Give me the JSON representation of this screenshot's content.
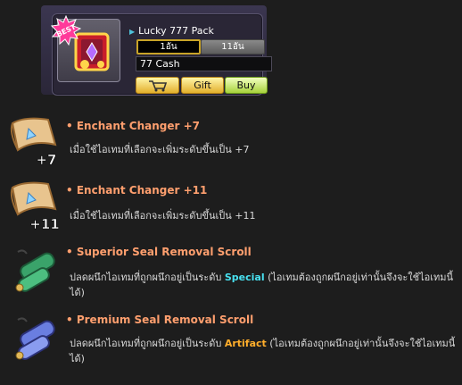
{
  "shop": {
    "title": "Lucky 777 Pack",
    "badge": "BEST",
    "options": [
      "1อัน",
      "11อัน"
    ],
    "price": "77 Cash",
    "gift_label": "Gift",
    "buy_label": "Buy",
    "cart_icon": "cart-icon"
  },
  "items": [
    {
      "name": "• Enchant Changer +7",
      "desc_before": "เมื่อใช้ไอเทมที่เลือกจะเพิ่มระดับขึ้นเป็น +7",
      "highlight": "",
      "desc_after": "",
      "icon_overlay": "+7"
    },
    {
      "name": "• Enchant Changer +11",
      "desc_before": "เมื่อใช้ไอเทมที่เลือกจะเพิ่มระดับขึ้นเป็น +11",
      "highlight": "",
      "desc_after": "",
      "icon_overlay": "+11"
    },
    {
      "name": "• Superior Seal Removal Scroll",
      "desc_before": "ปลดผนึกไอเทมที่ถูกผนึกอยู่เป็นระดับ ",
      "highlight": "Special",
      "desc_after": " (ไอเทมต้องถูกผนึกอยู่เท่านั้นจึงจะใช้ไอเทมนี้ได้)",
      "icon_overlay": ""
    },
    {
      "name": "• Premium Seal Removal Scroll",
      "desc_before": "ปลดผนึกไอเทมที่ถูกผนึกอยู่เป็นระดับ ",
      "highlight": "Artifact",
      "desc_after": " (ไอเทมต้องถูกผนึกอยู่เท่านั้นจึงจะใช้ไอเทมนี้ได้)",
      "icon_overlay": ""
    }
  ],
  "colors": {
    "item_name": "#ff9f6e",
    "special": "#48e1f0",
    "artifact": "#ffae2b"
  }
}
